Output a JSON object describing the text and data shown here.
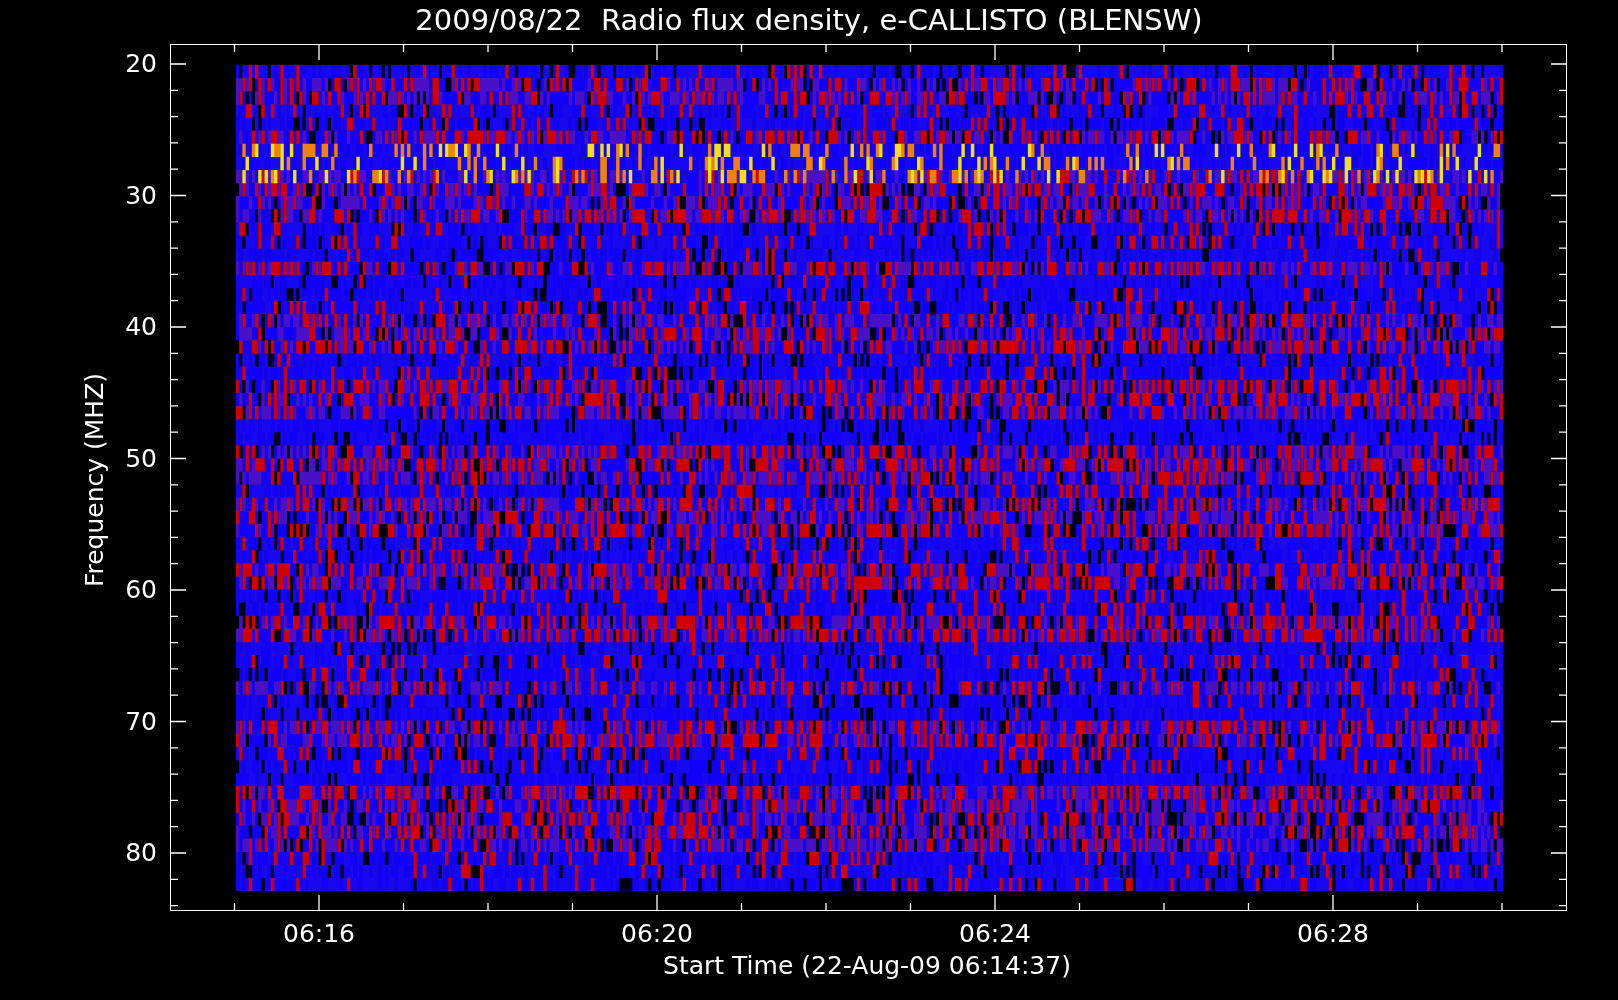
{
  "title": "2009/08/22  Radio flux density, e-CALLISTO (BLENSW)",
  "y_axis": {
    "label": "Frequency (MHZ)",
    "ticks": [
      "20",
      "30",
      "40",
      "50",
      "60",
      "70",
      "80"
    ]
  },
  "x_axis": {
    "label": "Start Time (22-Aug-09 06:14:37)",
    "ticks": [
      "06:16",
      "06:20",
      "06:24",
      "06:28"
    ]
  }
}
